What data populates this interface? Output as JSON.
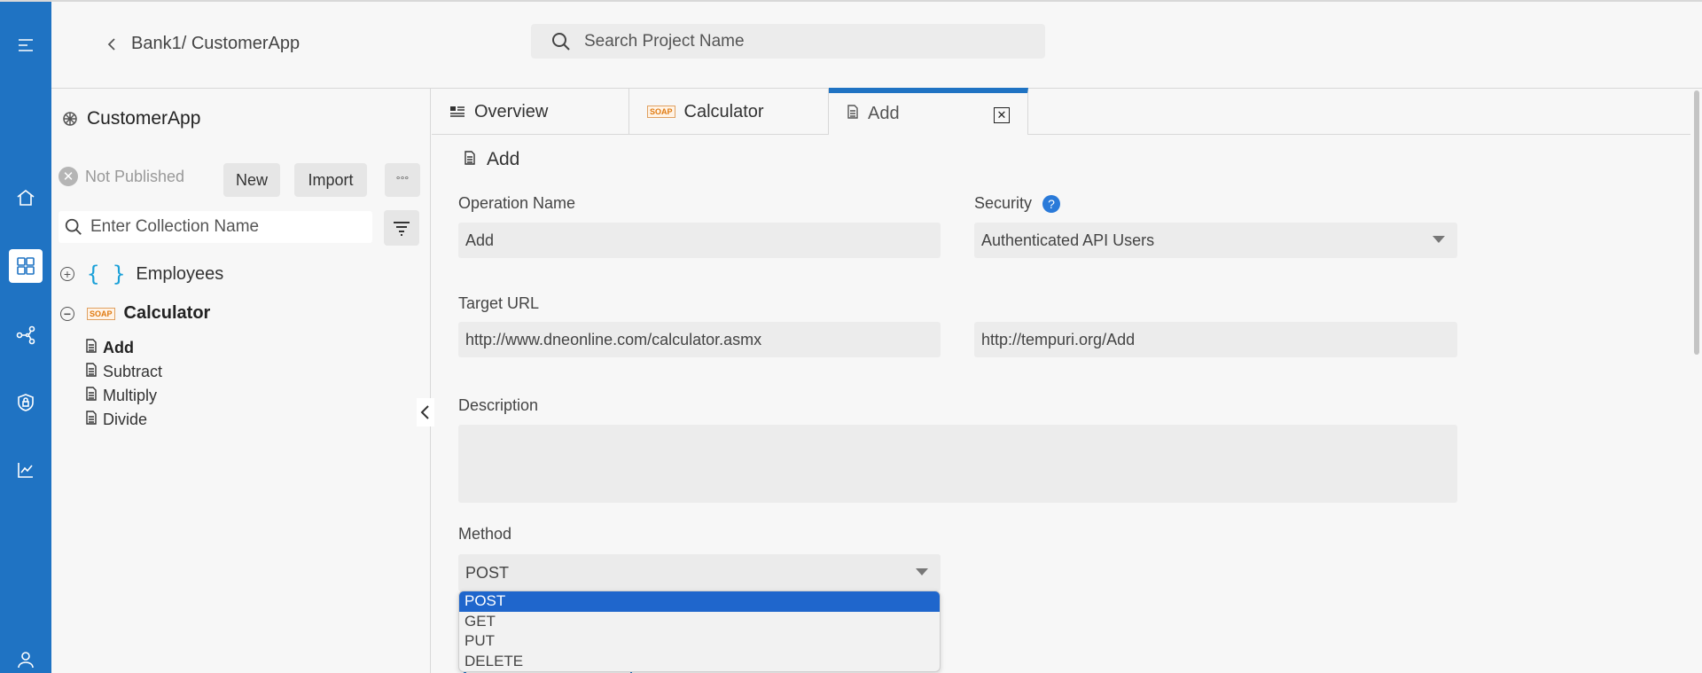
{
  "header": {
    "breadcrumb": "Bank1/ CustomerApp",
    "search_placeholder": "Search Project Name"
  },
  "rail": {
    "icons": [
      "menu-icon",
      "home-icon",
      "dashboard-icon",
      "share-icon",
      "shield-icon",
      "chart-icon",
      "user-icon"
    ],
    "active": "dashboard-icon",
    "color": "#1f73c3"
  },
  "sidebar": {
    "project_title": "CustomerApp",
    "status": "Not Published",
    "new_label": "New",
    "import_label": "Import",
    "more_label": "°°°",
    "collection_search_placeholder": "Enter Collection Name",
    "collections": [
      {
        "name": "Employees",
        "toggle": "+",
        "icon": "{ }"
      },
      {
        "name": "Calculator",
        "toggle": "−",
        "icon": "SOAP"
      }
    ],
    "operations": [
      "Add",
      "Subtract",
      "Multiply",
      "Divide"
    ]
  },
  "tabs": [
    {
      "label": "Overview",
      "icon": "overview-icon"
    },
    {
      "label": "Calculator",
      "icon": "soap-icon"
    },
    {
      "label": "Add",
      "icon": "document-icon",
      "active": true
    }
  ],
  "form": {
    "title": "Add",
    "operation_name_label": "Operation Name",
    "operation_name_value": "Add",
    "security_label": "Security",
    "security_help": "?",
    "security_value": "Authenticated API Users",
    "target_url_label": "Target URL",
    "target_url_value": "http://www.dneonline.com/calculator.asmx",
    "soap_action_value": "http://tempuri.org/Add",
    "description_label": "Description",
    "description_value": "",
    "method_label": "Method",
    "method_value": "POST",
    "method_options": [
      "POST",
      "GET",
      "PUT",
      "DELETE"
    ],
    "method_selected": "POST"
  },
  "colors": {
    "accent": "#1f73c3",
    "selected_option": "#1f66cc",
    "help_badge": "#2a7ad9",
    "employees_braces": "#1aa0d8"
  }
}
